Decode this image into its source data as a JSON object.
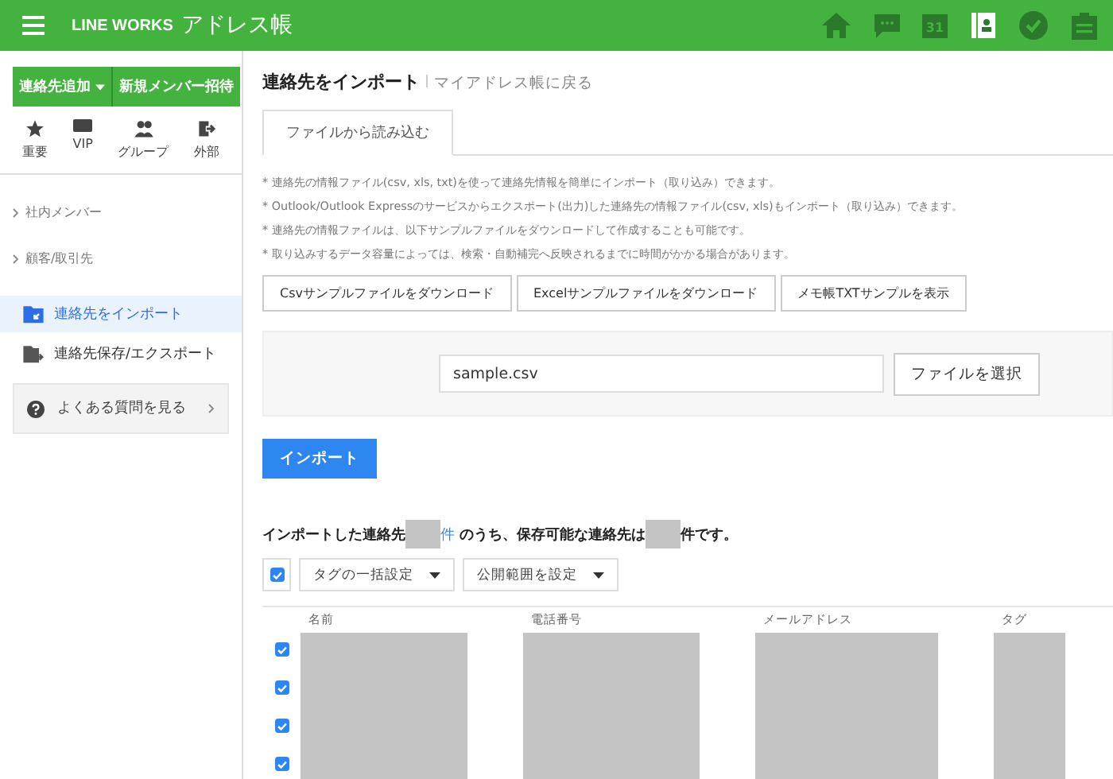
{
  "header": {
    "brand": "LINE WORKS",
    "title": "アドレス帳",
    "calendar_day": "31",
    "apps": [
      {
        "kind": "home",
        "selected": false
      },
      {
        "kind": "chat",
        "selected": false
      },
      {
        "kind": "calendar",
        "selected": false
      },
      {
        "kind": "contacts",
        "selected": true
      },
      {
        "kind": "check",
        "selected": false
      },
      {
        "kind": "board",
        "selected": false
      }
    ]
  },
  "sidebar": {
    "add_button": "連絡先追加",
    "invite_button": "新規メンバー招待",
    "shortcuts": [
      {
        "kind": "star",
        "label": "重要"
      },
      {
        "kind": "vip",
        "label": "VIP"
      },
      {
        "kind": "group",
        "label": "グループ"
      },
      {
        "kind": "external",
        "label": "外部"
      }
    ],
    "sections": [
      "社内メンバー",
      "顧客/取引先"
    ],
    "items": [
      {
        "kind": "import",
        "label": "連絡先をインポート",
        "selected": true
      },
      {
        "kind": "export",
        "label": "連絡先保存/エクスポート",
        "selected": false
      }
    ],
    "faq": "よくある質問を見る"
  },
  "main": {
    "title": "連絡先をインポート",
    "back_link": "マイアドレス帳に戻る",
    "tabs": [
      {
        "label": "ファイルから読み込む",
        "selected": true
      }
    ],
    "notes": [
      "* 連絡先の情報ファイル(csv, xls, txt)を使って連絡先情報を簡単にインポート（取り込み）できます。",
      "* Outlook/Outlook Expressのサービスからエクスポート(出力)した連絡先の情報ファイル(csv, xls)もインポート（取り込み）できます。",
      "* 連絡先の情報ファイルは、以下サンプルファイルをダウンロードして作成することも可能です。",
      "* 取り込みするデータ容量によっては、検索・自動補完へ反映されるまでに時間がかかる場合があります。"
    ],
    "sample_buttons": [
      "Csvサンプルファイルをダウンロード",
      "Excelサンプルファイルをダウンロード",
      "メモ帳TXTサンプルを表示"
    ],
    "file_name": "sample.csv",
    "choose_button": "ファイルを選択",
    "import_button": "インポート",
    "summary": {
      "prefix": "インポートした連絡先",
      "unit": "件",
      "middle": "のうち、保存可能な連絡先は",
      "suffix": "件です。"
    },
    "select_all": {
      "checked": true
    },
    "bulk_buttons": [
      "タグの一括設定",
      "公開範囲を設定"
    ],
    "table": {
      "columns": [
        "名前",
        "電話番号",
        "メールアドレス",
        "タグ"
      ],
      "rows": [
        {
          "checked": true
        },
        {
          "checked": true
        },
        {
          "checked": true
        },
        {
          "checked": true
        }
      ]
    }
  }
}
